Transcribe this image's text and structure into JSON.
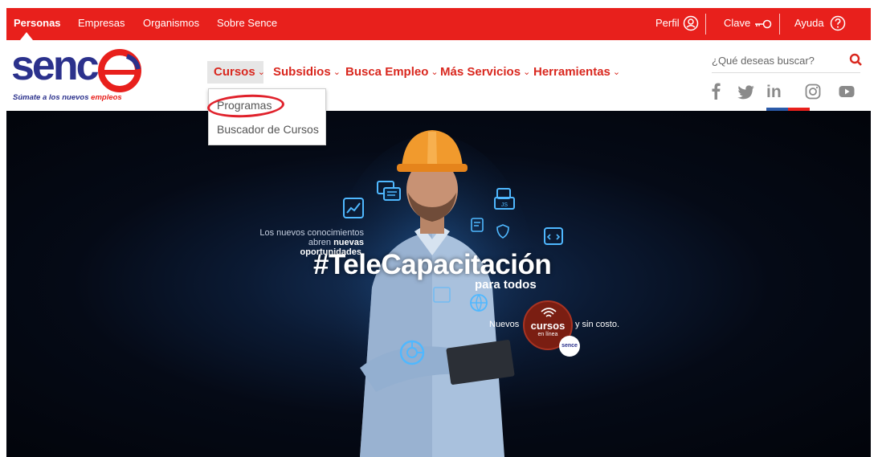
{
  "topbar": {
    "links": [
      "Personas",
      "Empresas",
      "Organismos",
      "Sobre Sence"
    ],
    "active": "Personas",
    "perfil": "Perfil",
    "clave": "Clave",
    "ayuda": "Ayuda"
  },
  "logo": {
    "word": "senc",
    "tagline_a": "Súmate a los nuevos ",
    "tagline_b": "empleos"
  },
  "nav": {
    "items": [
      "Cursos",
      "Subsidios",
      "Busca Empleo",
      "Más Servicios",
      "Herramientas"
    ],
    "open_item": "Cursos"
  },
  "dropdown": {
    "items": [
      "Programas",
      "Buscador de Cursos"
    ],
    "highlighted": "Programas"
  },
  "search": {
    "placeholder": "¿Qué deseas buscar?"
  },
  "social": [
    "facebook-icon",
    "twitter-icon",
    "linkedin-icon",
    "instagram-icon",
    "youtube-icon"
  ],
  "hero": {
    "small_line1": "Los nuevos conocimientos",
    "small_line2a": "abren ",
    "small_line2b": "nuevas oportunidades.",
    "headline": "#TeleCapacitación",
    "subhead": "para todos",
    "nuevos": "Nuevos",
    "badge_title": "cursos",
    "badge_sub": "en línea",
    "sin_costo": "y sin costo.",
    "badge_logo": "sence"
  },
  "colors": {
    "brand_red": "#e8201c",
    "brand_blue": "#2b318c",
    "hero_bg": "#050a16"
  }
}
